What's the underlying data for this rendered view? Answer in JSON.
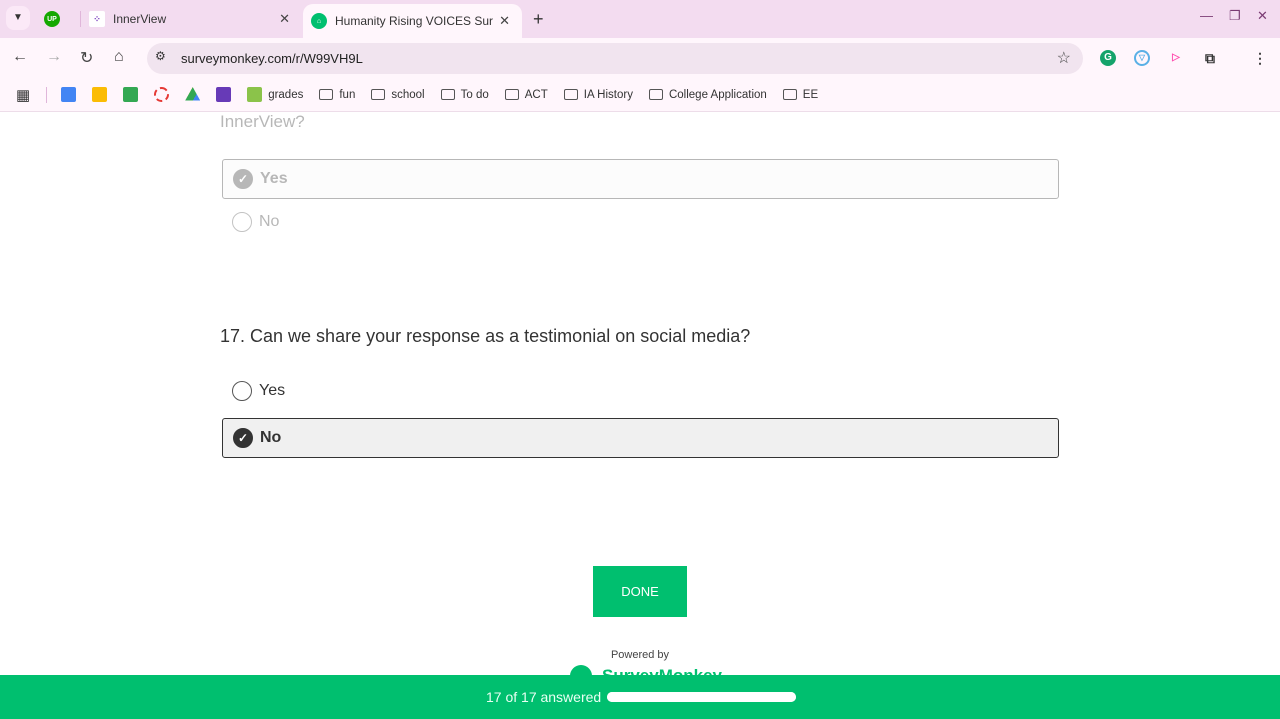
{
  "browser": {
    "tabs": [
      {
        "label": "InnerView",
        "active": false
      },
      {
        "label": "Humanity Rising VOICES Surve",
        "active": true
      }
    ],
    "pinned_tab": "UP",
    "new_tab": "+",
    "url": "surveymonkey.com/r/W99VH9L",
    "bookmarks": [
      "grades",
      "fun",
      "school",
      "To do",
      "ACT",
      "IA History",
      "College Application",
      "EE"
    ]
  },
  "survey": {
    "prev_question_tail": "InnerView?",
    "prev_options": [
      "Yes",
      "No"
    ],
    "prev_selected": "Yes",
    "question": "17. Can we share your response as a testimonial on social media?",
    "options": [
      "Yes",
      "No"
    ],
    "selected": "No",
    "done_label": "DONE",
    "powered_by": "Powered by",
    "brand": "SurveyMonkey"
  },
  "progress": {
    "label": "17 of 17 answered",
    "answered": 17,
    "total": 17,
    "fraction": 1.0
  },
  "colors": {
    "brand": "#00bf6f",
    "tabbar": "#f3dcf0"
  }
}
